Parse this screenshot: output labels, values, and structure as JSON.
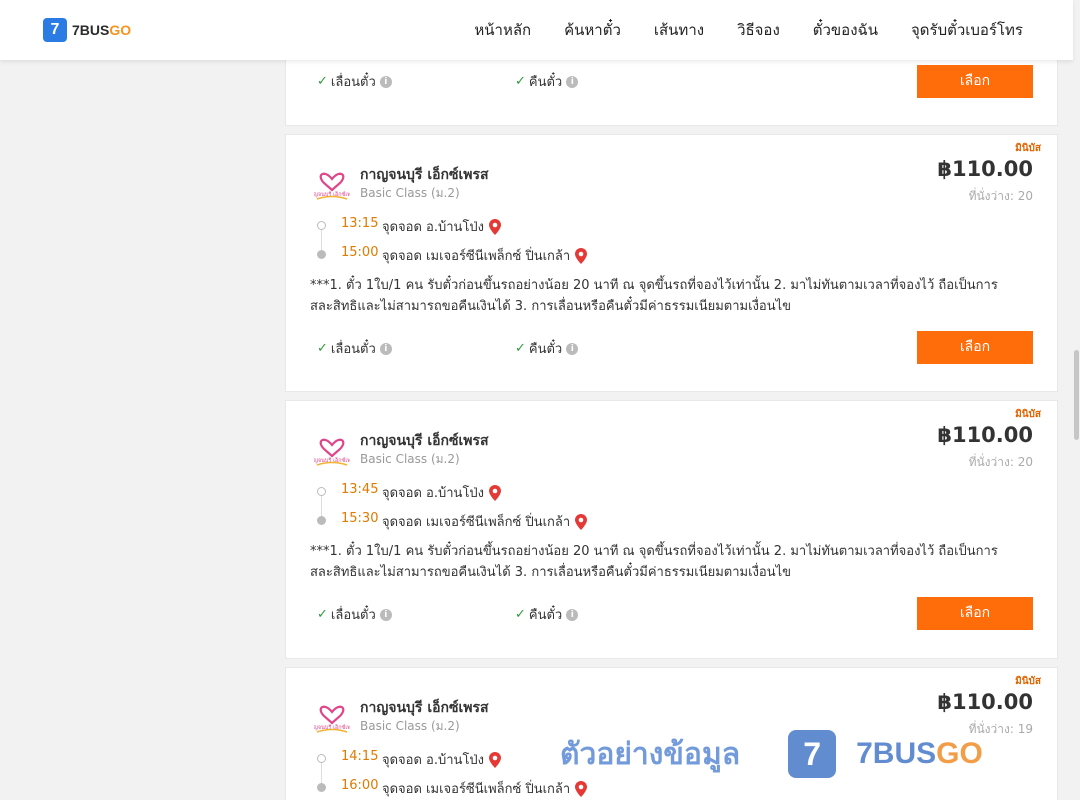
{
  "header": {
    "logo_mark": "7",
    "logo_text_a": "7BUS",
    "logo_text_b": "GO",
    "nav": [
      "หน้าหลัก",
      "ค้นหาตั๋ว",
      "เส้นทาง",
      "วิธีจอง",
      "ตั๋วของฉัน",
      "จุดรับตั๋วเบอร์โทร"
    ]
  },
  "colors": {
    "accent": "#ff6d0a",
    "time": "#e07a00",
    "check": "#2e9b3a",
    "brand_blue": "#2b7be4"
  },
  "feature_labels": {
    "reschedule": "เลื่อนตั๋ว",
    "refund": "คืนตั๋ว",
    "select": "เลือก"
  },
  "trips": [
    {
      "tag": "มินิบัส",
      "operator": "กาญจนบุรี เอ็กซ์เพรส",
      "operator_logo_text": "กาญจนบุรี เอ็กซ์เพรส",
      "class": "Basic Class (ม.2)",
      "price": "฿110.00",
      "seats": "ที่นั่งว่าง: 20",
      "depart_time": "13:15",
      "depart_place": "จุดจอด อ.บ้านโป่ง",
      "arrive_time": "15:00",
      "arrive_place": "จุดจอด เมเจอร์ซีนีเพล็กซ์ ปิ่นเกล้า",
      "note": "***1. ตั๋ว 1ใบ/1 คน รับตั๋วก่อนขึ้นรถอย่างน้อย 20 นาที ณ จุดขึ้นรถที่จองไว้เท่านั้น 2. มาไม่ทันตามเวลาที่จองไว้ ถือเป็นการสละสิทธิและไม่สามารถขอคืนเงินได้ 3. การเลื่อนหรือคืนตั๋วมีค่าธรรมเนียมตามเงื่อนไข"
    },
    {
      "tag": "มินิบัส",
      "operator": "กาญจนบุรี เอ็กซ์เพรส",
      "operator_logo_text": "กาญจนบุรี เอ็กซ์เพรส",
      "class": "Basic Class (ม.2)",
      "price": "฿110.00",
      "seats": "ที่นั่งว่าง: 20",
      "depart_time": "13:45",
      "depart_place": "จุดจอด อ.บ้านโป่ง",
      "arrive_time": "15:30",
      "arrive_place": "จุดจอด เมเจอร์ซีนีเพล็กซ์ ปิ่นเกล้า",
      "note": "***1. ตั๋ว 1ใบ/1 คน รับตั๋วก่อนขึ้นรถอย่างน้อย 20 นาที ณ จุดขึ้นรถที่จองไว้เท่านั้น 2. มาไม่ทันตามเวลาที่จองไว้ ถือเป็นการสละสิทธิและไม่สามารถขอคืนเงินได้ 3. การเลื่อนหรือคืนตั๋วมีค่าธรรมเนียมตามเงื่อนไข"
    },
    {
      "tag": "มินิบัส",
      "operator": "กาญจนบุรี เอ็กซ์เพรส",
      "operator_logo_text": "กาญจนบุรี เอ็กซ์เพรส",
      "class": "Basic Class (ม.2)",
      "price": "฿110.00",
      "seats": "ที่นั่งว่าง: 19",
      "depart_time": "14:15",
      "depart_place": "จุดจอด อ.บ้านโป่ง",
      "arrive_time": "16:00",
      "arrive_place": "จุดจอด เมเจอร์ซีนีเพล็กซ์ ปิ่นเกล้า"
    }
  ],
  "watermark": {
    "text": "ตัวอย่างข้อมูล",
    "logo_mark": "7",
    "brand_a": "7BUS",
    "brand_b": "GO"
  }
}
